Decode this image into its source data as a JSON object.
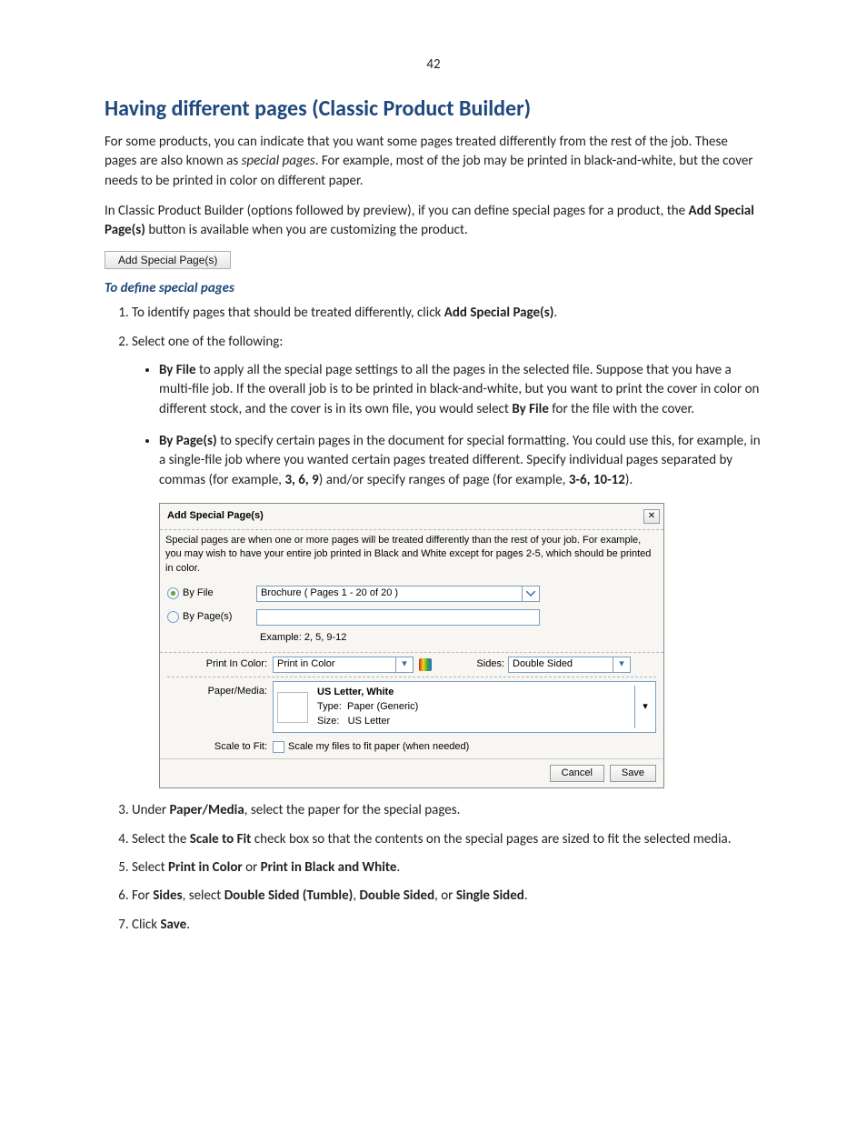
{
  "page_number": "42",
  "heading": "Having different pages (Classic Product Builder)",
  "intro1_a": "For some products, you can indicate that you want some pages treated differently from the rest of the job. These pages are also known as ",
  "intro1_b": "special pages",
  "intro1_c": ". For example, most of the job may be printed in black-and-white, but the cover needs to be printed in color on different paper.",
  "intro2_a": "In Classic Product Builder (options followed by preview), if you can define special pages for a product, the ",
  "intro2_b": "Add Special Page(s)",
  "intro2_c": " button is available when you are customizing the product.",
  "btn_label": "Add Special Page(s)",
  "subhead": "To define special pages",
  "step1_a": "To identify pages that should be treated differently, click ",
  "step1_b": "Add Special Page(s)",
  "step1_c": ".",
  "step2": "Select one of the following:",
  "bullet1_a": "By File",
  "bullet1_b": " to apply all the special page settings to all the pages in the selected file. Suppose that you have a multi-file job. If the overall job is to be printed in black-and-white, but you want to print the cover in color on different stock, and the cover is in its own file, you would select ",
  "bullet1_c": "By File",
  "bullet1_d": " for the file with the cover.",
  "bullet2_a": "By Page(s)",
  "bullet2_b": " to specify certain pages in the document for special formatting. You could use this, for example, in a single-file job where you wanted certain pages treated different. Specify individual pages separated by commas (for example, ",
  "bullet2_c": "3, 6, 9",
  "bullet2_d": ") and/or specify ranges of page (for example, ",
  "bullet2_e": "3-6, 10-12",
  "bullet2_f": ").",
  "dialog": {
    "title": "Add Special Page(s)",
    "desc": "Special pages are when one or more pages will be treated differently than the rest of your job. For example, you may wish to have your entire job printed in Black and White except for pages 2-5, which should be printed in color.",
    "by_file": "By File",
    "by_page": "By Page(s)",
    "file_value": "Brochure ( Pages 1 - 20 of 20 )",
    "example": "Example: 2, 5, 9-12",
    "print_color_label": "Print In Color:",
    "print_color_value": "Print in Color",
    "sides_label": "Sides:",
    "sides_value": "Double Sided",
    "paper_label": "Paper/Media:",
    "media_title": "US Letter, White",
    "media_type_lbl": "Type:",
    "media_type_val": "Paper (Generic)",
    "media_size_lbl": "Size:",
    "media_size_val": "US Letter",
    "scale_label": "Scale to Fit:",
    "scale_check": "Scale my files to fit paper (when needed)",
    "cancel": "Cancel",
    "save": "Save"
  },
  "step3_a": "Under ",
  "step3_b": "Paper/Media",
  "step3_c": ", select the paper for the special pages.",
  "step4_a": "Select the ",
  "step4_b": "Scale to Fit",
  "step4_c": " check box so that the contents on the special pages are sized to fit the selected media.",
  "step5_a": "Select ",
  "step5_b": "Print in Color",
  "step5_c": " or ",
  "step5_d": "Print in Black and White",
  "step5_e": ".",
  "step6_a": "For ",
  "step6_b": "Sides",
  "step6_c": ", select ",
  "step6_d": "Double Sided (Tumble)",
  "step6_e": ", ",
  "step6_f": "Double Sided",
  "step6_g": ", or ",
  "step6_h": "Single Sided",
  "step6_i": ".",
  "step7_a": "Click ",
  "step7_b": "Save",
  "step7_c": "."
}
